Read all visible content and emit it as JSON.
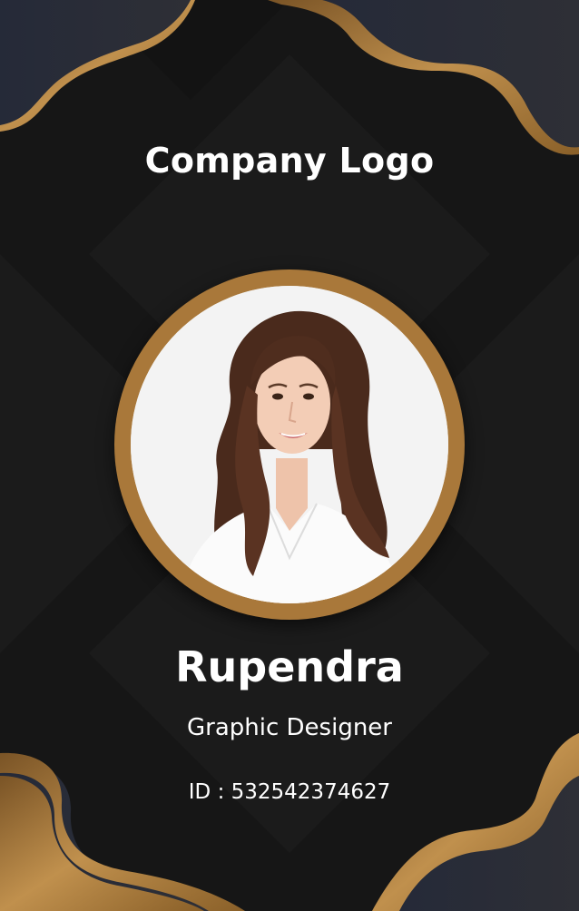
{
  "card": {
    "logo_text": "Company Logo",
    "name": "Rupendra",
    "title": "Graphic Designer",
    "id_line": "ID : 532542374627"
  },
  "colors": {
    "background": "#161616",
    "accent_gold": "#a9783a",
    "navy_wave": "#1c2233",
    "text": "#ffffff"
  },
  "photo": {
    "description": "portrait-photo"
  }
}
